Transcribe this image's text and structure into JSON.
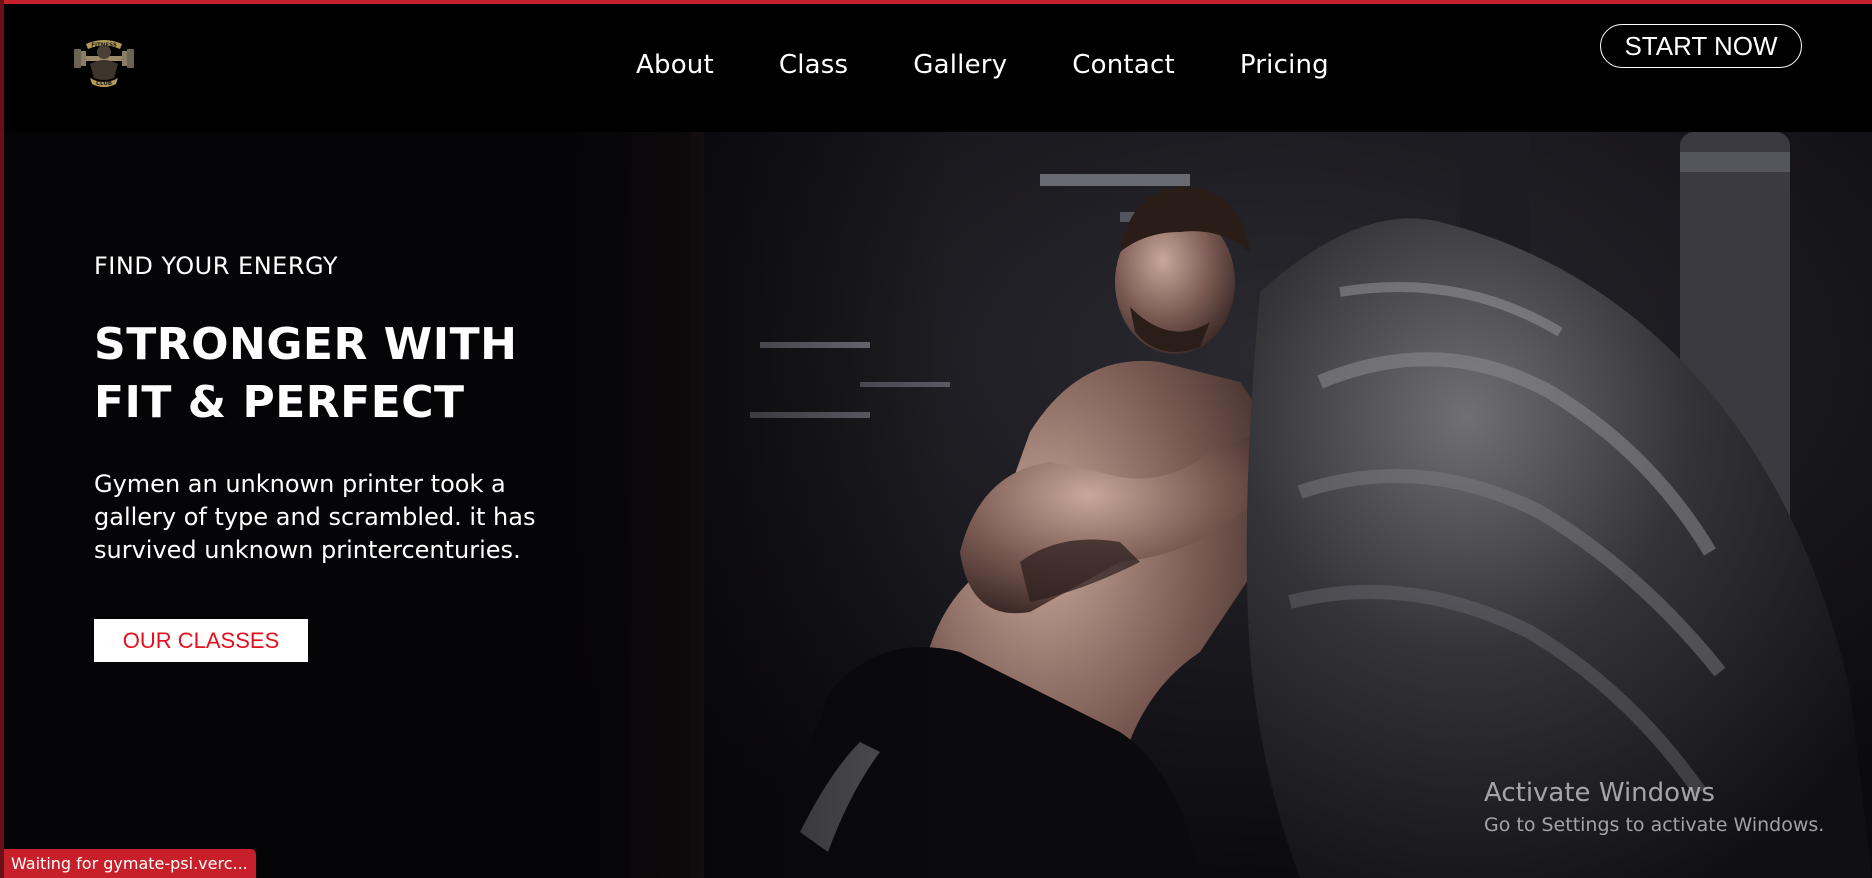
{
  "brand": {
    "logo_icon": "dumbbell-fitness-club-logo",
    "logo_line1": "FITNESS",
    "logo_line2": "CLUB",
    "accent_color": "#c7202a"
  },
  "nav": {
    "links": [
      "About",
      "Class",
      "Gallery",
      "Contact",
      "Pricing"
    ],
    "cta_label": "START NOW"
  },
  "hero": {
    "eyebrow": "FIND YOUR ENERGY",
    "headline_line1": "STRONGER WITH",
    "headline_line2": "FIT & PERFECT",
    "description": "Gymen an unknown printer took a gallery of type and scrambled. it has survived unknown printercenturies.",
    "button_label": "OUR CLASSES",
    "button_text_color": "#e3111f",
    "image": "man-flipping-tire-photo"
  },
  "watermark": {
    "title": "Activate Windows",
    "subtitle": "Go to Settings to activate Windows."
  },
  "status_bar": {
    "text": "Waiting for gymate-psi.verc..."
  }
}
